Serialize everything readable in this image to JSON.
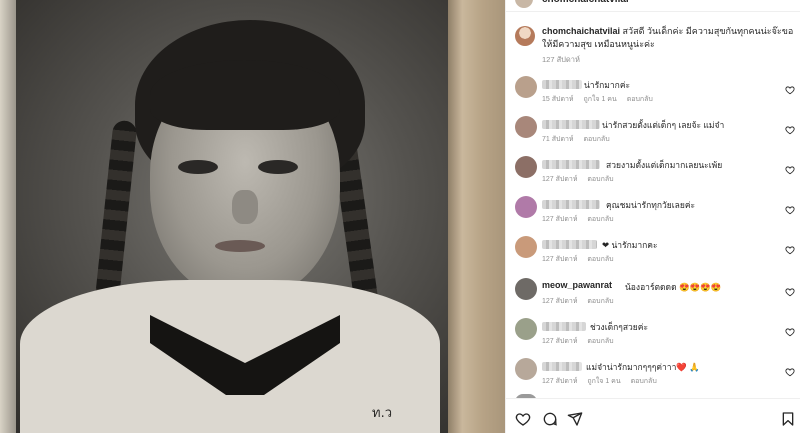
{
  "post": {
    "header_username": "chomchaichatvilai",
    "photo_badge": "ท.ว"
  },
  "caption": {
    "username": "chomchaichatvilai",
    "text": "สวัสดี วันเด็กค่ะ มีความสุขกันทุกคนน่ะจ๊ะขอให้มีความสุข เหมือนหนูน่ะค่ะ",
    "time": "127 สัปดาห์"
  },
  "comments": [
    {
      "username_visible": false,
      "text": "น่ารักมากค่ะ",
      "time": "15 สัปดาห์",
      "likes": "ถูกใจ 1 คน",
      "reply": "ตอบกลับ",
      "avatar_color": "#b9a08c"
    },
    {
      "username_visible": false,
      "text": "น่ารักสวยตั้งแต่เด็กๆ เลยจ้ะ แม่จ๋า",
      "time": "71 สัปดาห์",
      "likes": "",
      "reply": "ตอบกลับ",
      "avatar_color": "#a8877a"
    },
    {
      "username_visible": false,
      "text": "สวยงามตั้งแต่เด็กมากเลยนะเพ้ย",
      "time": "127 สัปดาห์",
      "likes": "",
      "reply": "ตอบกลับ",
      "avatar_color": "#8c6f66"
    },
    {
      "username_visible": false,
      "text": "คุณชมน่ารักทุกวัยเลยค่ะ",
      "time": "127 สัปดาห์",
      "likes": "",
      "reply": "ตอบกลับ",
      "avatar_color": "#b07aa8"
    },
    {
      "username_visible": false,
      "text": "❤ น่ารักมากคะ",
      "time": "127 สัปดาห์",
      "likes": "",
      "reply": "ตอบกลับ",
      "avatar_color": "#c99a7a"
    },
    {
      "username_visible": true,
      "username": "meow_pawanrat",
      "text": "น้องอาร์ตดดด 😍😍😍😍",
      "time": "127 สัปดาห์",
      "likes": "",
      "reply": "ตอบกลับ",
      "avatar_color": "#6e6a66"
    },
    {
      "username_visible": false,
      "text": "ช่วงเด็กๆสวยค่ะ",
      "time": "127 สัปดาห์",
      "likes": "",
      "reply": "ตอบกลับ",
      "avatar_color": "#9aa08a"
    },
    {
      "username_visible": false,
      "text": "แม่จ๋าน่ารักมากๆๆๆค่าาา❤️ 🙏",
      "time": "127 สัปดาห์",
      "likes": "ถูกใจ 1 คน",
      "reply": "ตอบกลับ",
      "avatar_color": "#b7a89a"
    }
  ],
  "colors": {
    "meta_text": "#8e8e8e",
    "primary_text": "#262626",
    "divider": "#efefef",
    "heart_red": "#ed4956"
  },
  "icons": [
    "heart-icon",
    "comment-icon",
    "share-icon",
    "bookmark-icon"
  ]
}
